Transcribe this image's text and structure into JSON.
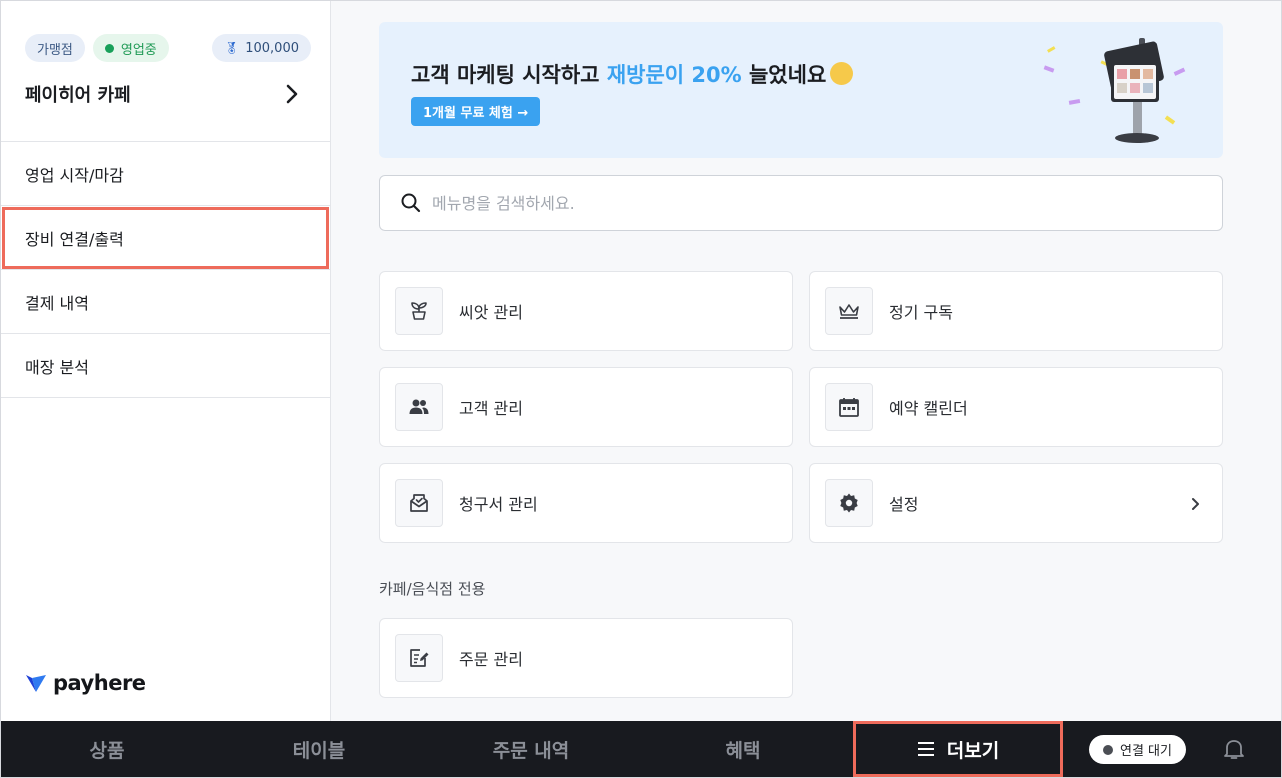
{
  "sidebar": {
    "badges": {
      "type": "가맹점",
      "status": "영업중",
      "seed": "100,000"
    },
    "store_name": "페이히어 카페",
    "items": [
      {
        "label": "영업 시작/마감"
      },
      {
        "label": "장비 연결/출력"
      },
      {
        "label": "결제 내역"
      },
      {
        "label": "매장 분석"
      }
    ],
    "logo_text": "payhere"
  },
  "banner": {
    "title_prefix": "고객 마케팅 시작하고 ",
    "title_highlight": "재방문이 20%",
    "title_suffix": " 늘었네요",
    "button_label": "1개월 무료 체험 →"
  },
  "search": {
    "placeholder": "메뉴명을 검색하세요.",
    "value": ""
  },
  "cards": [
    {
      "label": "씨앗 관리",
      "icon": "sprout-icon"
    },
    {
      "label": "정기 구독",
      "icon": "crown-icon"
    },
    {
      "label": "고객 관리",
      "icon": "people-icon"
    },
    {
      "label": "예약 캘린더",
      "icon": "calendar-icon"
    },
    {
      "label": "청구서 관리",
      "icon": "invoice-icon"
    },
    {
      "label": "설정",
      "icon": "gear-icon"
    }
  ],
  "section": {
    "title": "카페/음식점 전용",
    "cards": [
      {
        "label": "주문 관리",
        "icon": "order-edit-icon"
      }
    ]
  },
  "bottom_nav": {
    "tabs": [
      {
        "label": "상품"
      },
      {
        "label": "테이블"
      },
      {
        "label": "주문 내역"
      },
      {
        "label": "혜택"
      },
      {
        "label": "더보기"
      }
    ],
    "connection": "연결 대기"
  },
  "colors": {
    "accent": "#3aa2f0",
    "selection_outline": "#ee6b5b",
    "bottom_bar": "#181a1f",
    "status_green": "#19a05a"
  }
}
